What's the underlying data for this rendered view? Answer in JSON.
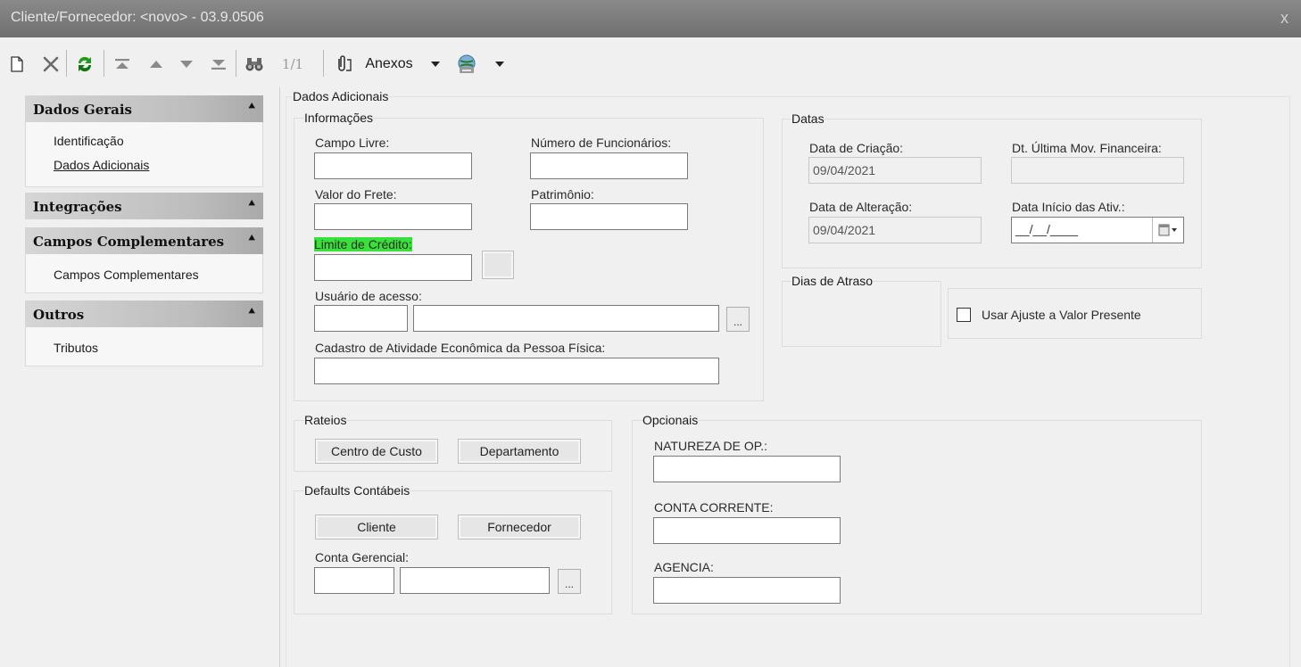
{
  "window": {
    "title": "Cliente/Fornecedor: <novo> - 03.9.0506",
    "close_glyph": "x"
  },
  "toolbar": {
    "record_counter": "1/1",
    "attachments_label": "Anexos",
    "icons": [
      "new-document-icon",
      "delete-icon",
      "refresh-icon",
      "first-record-icon",
      "previous-record-icon",
      "next-record-icon",
      "last-record-icon",
      "binoculars-icon",
      "paperclip-icon",
      "dropdown-arrow-icon",
      "globe-printer-icon",
      "dropdown-arrow-icon"
    ]
  },
  "nav": {
    "sections": [
      {
        "title": "Dados Gerais",
        "items": [
          "Identificação",
          "Dados Adicionais"
        ]
      },
      {
        "title": "Integrações",
        "items": []
      },
      {
        "title": "Campos Complementares",
        "items": [
          "Campos Complementares"
        ]
      },
      {
        "title": "Outros",
        "items": [
          "Tributos"
        ]
      }
    ],
    "collapse_glyph": "⌃"
  },
  "main": {
    "title": "Dados Adicionais",
    "informacoes": {
      "title": "Informações",
      "campo_livre": "Campo Livre:",
      "numero_funcionarios": "Número de Funcionários:",
      "valor_frete": "Valor do Frete:",
      "patrimonio": "Patrimônio:",
      "limite_credito": "Limite de Crédito:",
      "usuario_acesso": "Usuário de acesso:",
      "cadastro_atividade": "Cadastro de Atividade Econômica da Pessoa Física:",
      "dots": "..."
    },
    "datas": {
      "title": "Datas",
      "data_criacao_label": "Data de Criação:",
      "data_criacao_value": "09/04/2021",
      "ultima_mov_label": "Dt. Última Mov. Financeira:",
      "ultima_mov_value": "",
      "data_alteracao_label": "Data de Alteração:",
      "data_alteracao_value": "09/04/2021",
      "inicio_ativ_label": "Data Início das Ativ.:",
      "inicio_ativ_value": "__/__/____"
    },
    "dias_atraso": {
      "title": "Dias de Atraso"
    },
    "ajuste": {
      "label": "Usar Ajuste a Valor Presente",
      "checked": false
    },
    "rateios": {
      "title": "Rateios",
      "centro_custo": "Centro de Custo",
      "departamento": "Departamento"
    },
    "defaults": {
      "title": "Defaults Contábeis",
      "cliente": "Cliente",
      "fornecedor": "Fornecedor",
      "conta_gerencial": "Conta Gerencial:",
      "dots": "..."
    },
    "opcionais": {
      "title": "Opcionais",
      "natureza": "NATUREZA DE OP.:",
      "conta_corrente": "CONTA CORRENTE:",
      "agencia": "AGENCIA:"
    }
  },
  "colors": {
    "highlight": "#39e039",
    "title_bar": "#7c7c7c",
    "refresh_green": "#1f9a1f"
  }
}
